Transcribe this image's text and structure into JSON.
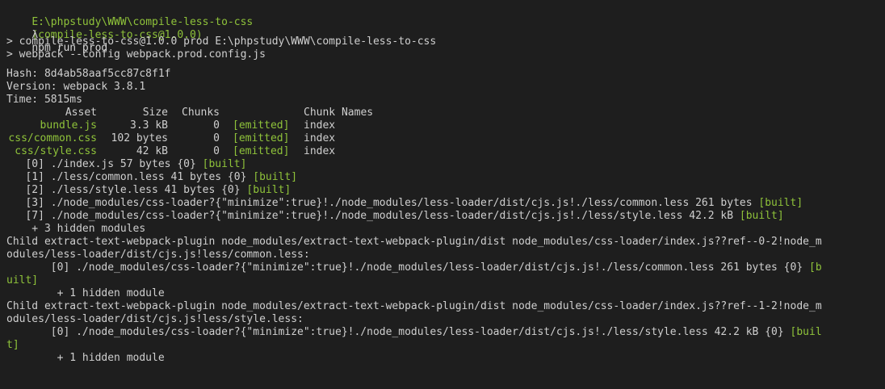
{
  "prompt": {
    "cwd": "E:\\phpstudy\\WWW\\compile-less-to-css",
    "package": "(compile-less-to-css@1.0.0)",
    "symbol": "λ",
    "command": "npm run prod"
  },
  "script_lines": [
    "> compile-less-to-css@1.0.0 prod E:\\phpstudy\\WWW\\compile-less-to-css",
    "> webpack --config webpack.prod.config.js"
  ],
  "build_info": {
    "hash": "Hash: 8d4ab58aaf5cc87c8f1f",
    "version": "Version: webpack 3.8.1",
    "time": "Time: 5815ms"
  },
  "asset_table": {
    "headers": {
      "asset": "Asset",
      "size": "Size",
      "chunks": "Chunks",
      "chunk_names": "Chunk Names"
    },
    "rows": [
      {
        "asset": "bundle.js",
        "size": "3.3 kB",
        "chunks": "0",
        "emitted": "[emitted]",
        "name": "index"
      },
      {
        "asset": "css/common.css",
        "size": "102 bytes",
        "chunks": "0",
        "emitted": "[emitted]",
        "name": "index"
      },
      {
        "asset": "css/style.css",
        "size": "42 kB",
        "chunks": "0",
        "emitted": "[emitted]",
        "name": "index"
      }
    ]
  },
  "modules": [
    {
      "text": "   [0] ./index.js 57 bytes {0} ",
      "tag": "[built]"
    },
    {
      "text": "   [1] ./less/common.less 41 bytes {0} ",
      "tag": "[built]"
    },
    {
      "text": "   [2] ./less/style.less 41 bytes {0} ",
      "tag": "[built]"
    },
    {
      "text": "   [3] ./node_modules/css-loader?{\"minimize\":true}!./node_modules/less-loader/dist/cjs.js!./less/common.less 261 bytes ",
      "tag": "[built]"
    },
    {
      "text": "   [7] ./node_modules/css-loader?{\"minimize\":true}!./node_modules/less-loader/dist/cjs.js!./less/style.less 42.2 kB ",
      "tag": "[built]"
    }
  ],
  "hidden_modules": "    + 3 hidden modules",
  "children": [
    {
      "line1": "Child extract-text-webpack-plugin node_modules/extract-text-webpack-plugin/dist node_modules/css-loader/index.js??ref--0-2!node_m",
      "line2": "odules/less-loader/dist/cjs.js!less/common.less:",
      "module": "       [0] ./node_modules/css-loader?{\"minimize\":true}!./node_modules/less-loader/dist/cjs.js!./less/common.less 261 bytes {0} ",
      "tag_start": "[b",
      "tag_end": "uilt]",
      "hidden": "        + 1 hidden module"
    },
    {
      "line1": "Child extract-text-webpack-plugin node_modules/extract-text-webpack-plugin/dist node_modules/css-loader/index.js??ref--1-2!node_m",
      "line2": "odules/less-loader/dist/cjs.js!less/style.less:",
      "module": "       [0] ./node_modules/css-loader?{\"minimize\":true}!./node_modules/less-loader/dist/cjs.js!./less/style.less 42.2 kB {0} ",
      "tag_start": "[buil",
      "tag_end": "t]",
      "hidden": "        + 1 hidden module"
    }
  ],
  "colors": {
    "background": "#1e1e1e",
    "text": "#cfcfcf",
    "accent_green": "#8fc33a"
  }
}
